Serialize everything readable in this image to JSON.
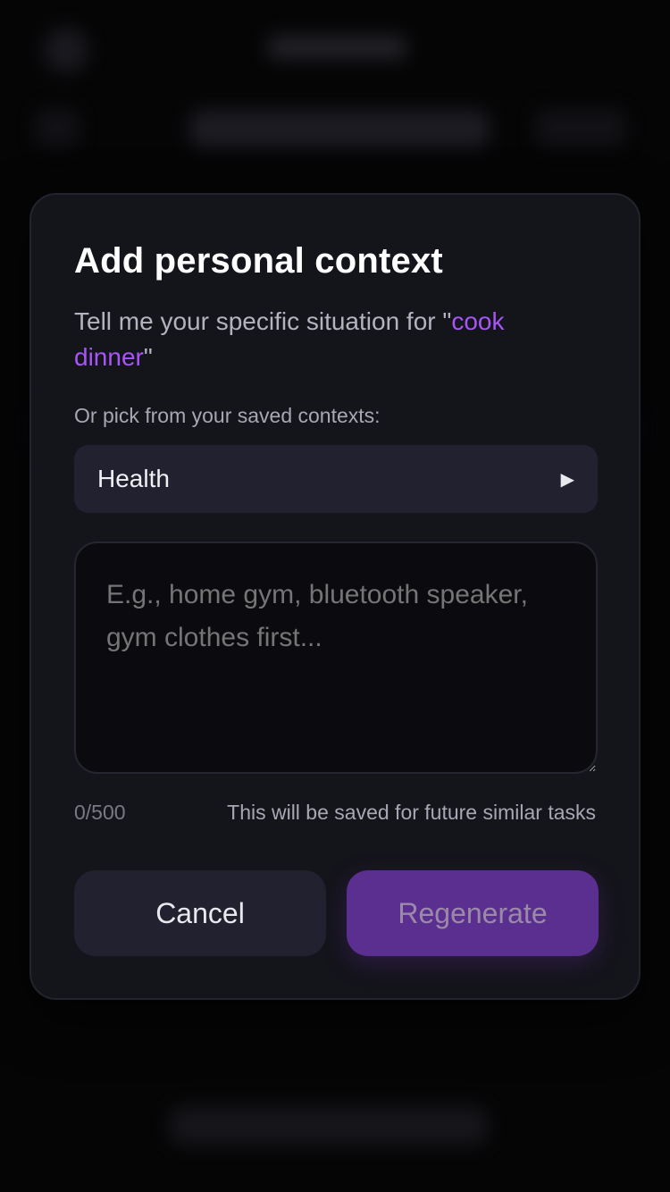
{
  "modal": {
    "title": "Add personal context",
    "subtitle_prefix": "Tell me your specific situation for \"",
    "task_name": "cook dinner",
    "subtitle_suffix": "\"",
    "saved_contexts_label": "Or pick from your saved contexts:",
    "saved_context_selected": "Health",
    "select_arrow_icon": "triangle-right-icon",
    "input_placeholder": "E.g., home gym, bluetooth speaker, gym clothes first...",
    "input_value": "",
    "char_count": "0/500",
    "save_note": "This will be saved for future similar tasks",
    "cancel_label": "Cancel",
    "regenerate_label": "Regenerate"
  },
  "colors": {
    "accent": "#a855f7",
    "primary_button": "#5b2f8f",
    "modal_bg": "#14141b",
    "page_bg": "#050506"
  }
}
